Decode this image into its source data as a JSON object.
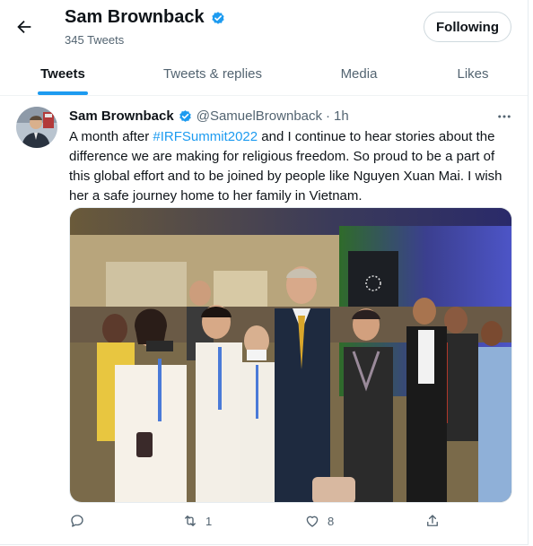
{
  "header": {
    "name": "Sam Brownback",
    "tweet_count": "345 Tweets",
    "follow_label": "Following"
  },
  "tabs": [
    {
      "label": "Tweets",
      "active": true
    },
    {
      "label": "Tweets & replies",
      "active": false
    },
    {
      "label": "Media",
      "active": false
    },
    {
      "label": "Likes",
      "active": false
    }
  ],
  "tweet": {
    "name": "Sam Brownback",
    "handle": "@SamuelBrownback",
    "separator": "·",
    "time": "1h",
    "text_before": "A month after ",
    "hashtag": "#IRFSummit2022",
    "text_after": " and I continue to hear stories about the difference we are making for religious freedom. So proud to be a part of this global effort and to be joined by people like Nguyen Xuan Mai. I wish her a safe journey home to her family in Vietnam.",
    "actions": {
      "reply_count": "",
      "retweet_count": "1",
      "like_count": "8"
    }
  },
  "icons": {
    "back": "arrow-left-icon",
    "verified": "verified-badge-icon",
    "more": "more-horizontal-icon",
    "reply": "reply-icon",
    "retweet": "retweet-icon",
    "like": "heart-icon",
    "share": "share-icon"
  },
  "colors": {
    "accent": "#1d9bf0",
    "text": "#0f1419",
    "secondary_text": "#536471"
  }
}
